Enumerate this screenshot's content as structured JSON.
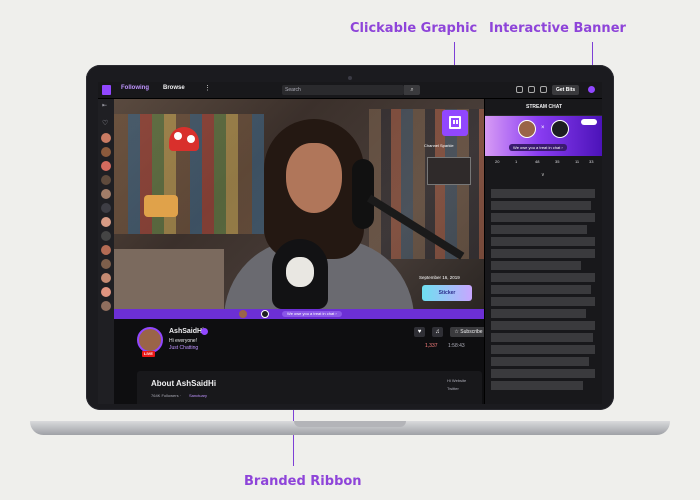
{
  "callouts": {
    "graphic": "Clickable Graphic",
    "banner": "Interactive Banner",
    "ribbon": "Branded Ribbon"
  },
  "topbar": {
    "following": "Following",
    "browse": "Browse",
    "more": "⋮",
    "search_placeholder": "Search",
    "bits": "Get Bits"
  },
  "video": {
    "card_label": "Channel Sparkle",
    "date": "September 16, 2019",
    "sticker": "Sticker"
  },
  "ribbon": {
    "text": "We owe you a treat in chat ›"
  },
  "channel": {
    "name": "AshSaidHi",
    "title": "Hi everyone!",
    "category": "Just Chatting",
    "live": "LIVE",
    "subscribe": "☆ Subscribe ∨",
    "viewers": "1,337",
    "uptime": "1:58:43"
  },
  "about": {
    "title": "About AshSaidHi",
    "followers": "764K Followers ·",
    "team": "Sanctuary",
    "link1": "Hi Website",
    "link2": "Twitter"
  },
  "chat": {
    "header": "STREAM CHAT",
    "banner_text": "We owe you a treat in chat ›",
    "stats": [
      "20",
      "1",
      "48",
      "35",
      "11",
      "33"
    ]
  },
  "colors": {
    "twitch_purple": "#9147ff",
    "callout": "#8e44d9",
    "ribbon": "#6c2fd4"
  },
  "icons": [
    "twitch-logo-icon",
    "search-icon",
    "heart-icon",
    "bell-icon",
    "chevron-down-icon",
    "more-icon",
    "verified-icon"
  ]
}
